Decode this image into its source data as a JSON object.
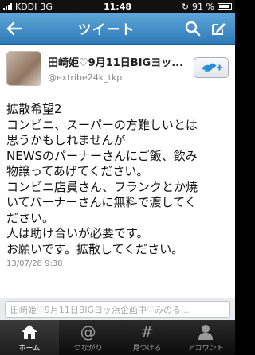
{
  "status_bar": {
    "carrier": "KDDI",
    "network": "3G",
    "time": "11:48",
    "battery": "91 %"
  },
  "nav": {
    "title": "ツイート"
  },
  "tweet": {
    "display_name": "田崎姫♡9月11日BIGヨッ...",
    "screen_name": "@extribe24k_tkp",
    "lines": [
      "拡散希望2",
      "コンビニ、スーパーの方難しいとは",
      "思うかもしれませんが",
      "NEWSのパーナーさんにご飯、飲み",
      "物譲ってあげてください。",
      "コンビニ店員さん、フランクとか焼",
      "いてパーナーさんに無料で渡してく",
      "ださい。",
      "人は助け合いが必要です。",
      "お願いです。拡散してください。"
    ],
    "timestamp": "13/07/28 9:38"
  },
  "reply": {
    "placeholder": "田崎姫♡9月11日BIGヨッ浜企画中♡みのる..."
  },
  "tabs": [
    {
      "label": "ホーム",
      "icon": "home-icon"
    },
    {
      "label": "つながり",
      "icon": "at-icon"
    },
    {
      "label": "見つける",
      "icon": "hash-icon"
    },
    {
      "label": "アカウント",
      "icon": "person-icon"
    }
  ],
  "colors": {
    "nav_top": "#5fa6d8",
    "nav_bottom": "#2f7ab8",
    "accent": "#2a8fd1"
  }
}
